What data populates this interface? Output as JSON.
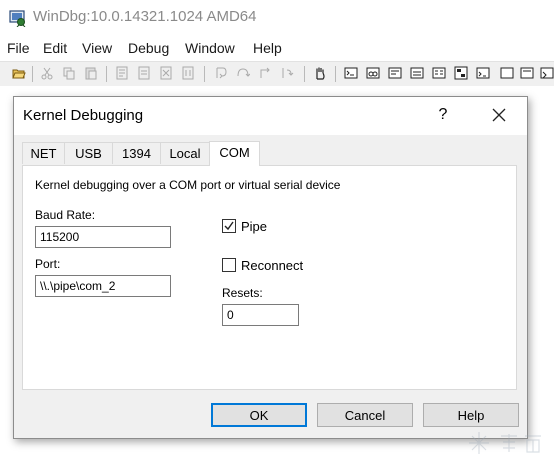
{
  "window": {
    "title": "WinDbg:10.0.14321.1024 AMD64"
  },
  "menu": {
    "items": [
      "File",
      "Edit",
      "View",
      "Debug",
      "Window",
      "Help"
    ]
  },
  "toolbar": {
    "icons": [
      "open-icon",
      "cut-icon",
      "copy-icon",
      "paste-icon",
      "go-icon",
      "restart-icon",
      "stop-icon",
      "break-icon",
      "step-into-icon",
      "step-over-icon",
      "step-out-icon",
      "run-to-cursor-icon",
      "hand-icon",
      "command-icon",
      "watch-icon",
      "locals-icon",
      "registers-icon",
      "memory-icon",
      "call-stack-icon",
      "disassembly-icon",
      "scratch-pad-icon",
      "processes-icon"
    ]
  },
  "dialog": {
    "title": "Kernel Debugging",
    "help_glyph": "?",
    "tabs": [
      "NET",
      "USB",
      "1394",
      "Local",
      "COM"
    ],
    "active_tab": "COM",
    "description": "Kernel debugging over a COM port or virtual serial device",
    "baud_rate": {
      "label": "Baud Rate:",
      "value": "115200"
    },
    "port": {
      "label": "Port:",
      "value": "\\\\.\\pipe\\com_2"
    },
    "pipe": {
      "label": "Pipe",
      "checked": true
    },
    "reconnect": {
      "label": "Reconnect",
      "checked": false
    },
    "resets": {
      "label": "Resets:",
      "value": "0"
    },
    "buttons": {
      "ok": "OK",
      "cancel": "Cancel",
      "help": "Help"
    }
  },
  "colors": {
    "dialog_bg": "#f0f0f0",
    "accent": "#0078d7",
    "title_text_inactive": "#8a8a8a"
  }
}
